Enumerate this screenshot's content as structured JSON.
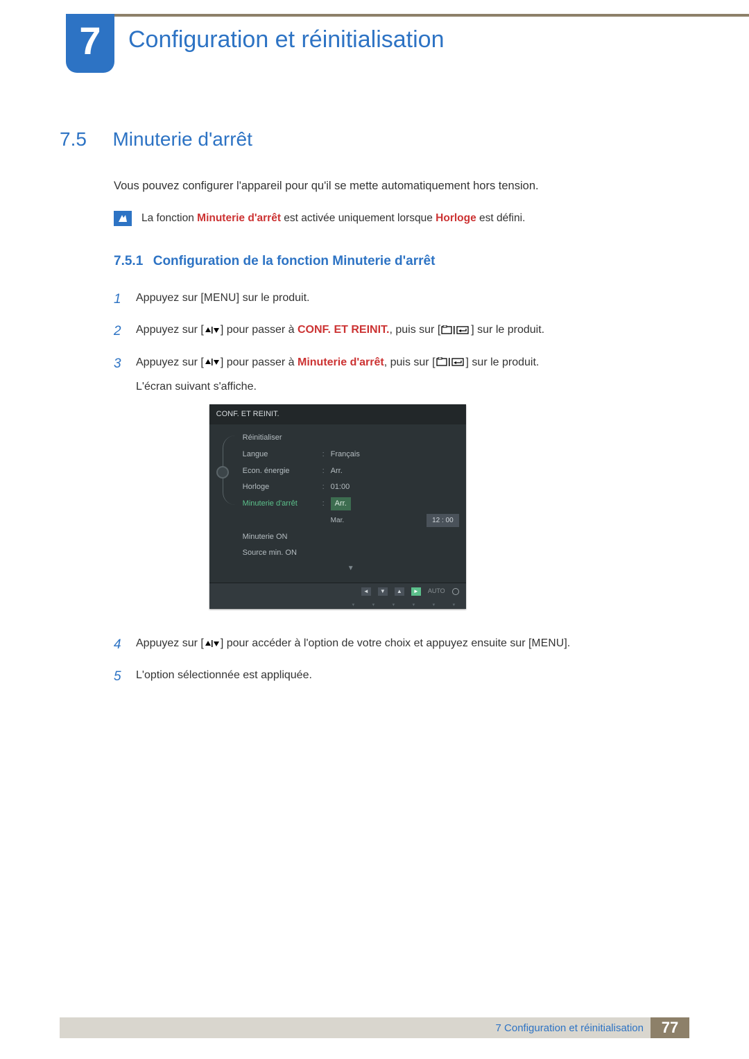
{
  "chapter": {
    "num": "7",
    "title": "Configuration et réinitialisation"
  },
  "section": {
    "num": "7.5",
    "title": "Minuterie d'arrêt"
  },
  "intro": "Vous pouvez configurer l'appareil pour qu'il se mette automatiquement hors tension.",
  "note": {
    "pre": "La fonction ",
    "h1": "Minuterie d'arrêt",
    "mid": " est activée uniquement lorsque ",
    "h2": "Horloge",
    "post": " est défini."
  },
  "subsection": {
    "num": "7.5.1",
    "title": "Configuration de la fonction Minuterie d'arrêt"
  },
  "steps": {
    "s1": {
      "n": "1",
      "a": "Appuyez sur [",
      "menu": "MENU",
      "b": "] sur le produit."
    },
    "s2": {
      "n": "2",
      "a": "Appuyez sur [",
      "b": "] pour passer à ",
      "h": "CONF. ET REINIT.",
      "c": ", puis sur [",
      "d": "] sur le produit."
    },
    "s3": {
      "n": "3",
      "a": "Appuyez sur [",
      "b": "] pour passer à ",
      "h": "Minuterie d'arrêt",
      "c": ", puis sur [",
      "d": "] sur le produit.",
      "e": "L'écran suivant s'affiche."
    },
    "s4": {
      "n": "4",
      "a": "Appuyez sur [",
      "b": "] pour accéder à l'option de votre choix et appuyez ensuite sur [",
      "menu": "MENU",
      "c": "]."
    },
    "s5": {
      "n": "5",
      "a": "L'option sélectionnée est appliquée."
    }
  },
  "osd": {
    "title": "CONF. ET REINIT.",
    "rows": {
      "r1": {
        "label": "Réinitialiser",
        "val": ""
      },
      "r2": {
        "label": "Langue",
        "val": "Français"
      },
      "r3": {
        "label": "Econ. énergie",
        "val": "Arr."
      },
      "r4": {
        "label": "Horloge",
        "val": "01:00"
      },
      "r5": {
        "label": "Minuterie d'arrêt",
        "val": "Arr."
      },
      "r6": {
        "label": "",
        "val": "Mar.",
        "time": "12 : 00"
      },
      "r7": {
        "label": "Minuterie ON",
        "val": ""
      },
      "r8": {
        "label": "Source min. ON",
        "val": ""
      }
    },
    "auto": "AUTO"
  },
  "footer": {
    "label": "7 Configuration et réinitialisation",
    "page": "77"
  }
}
